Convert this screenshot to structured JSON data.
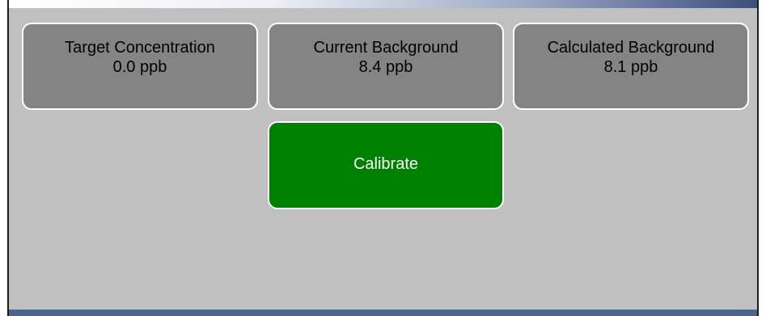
{
  "tiles": [
    {
      "label": "Target Concentration",
      "value": "0.0 ppb"
    },
    {
      "label": "Current Background",
      "value": "8.4 ppb"
    },
    {
      "label": "Calculated Background",
      "value": "8.1 ppb"
    }
  ],
  "calibrate_label": "Calibrate",
  "colors": {
    "panel": "#c0c0c0",
    "tile": "#848484",
    "calibrate": "#008000",
    "bottom_bar": "#4a6690"
  }
}
